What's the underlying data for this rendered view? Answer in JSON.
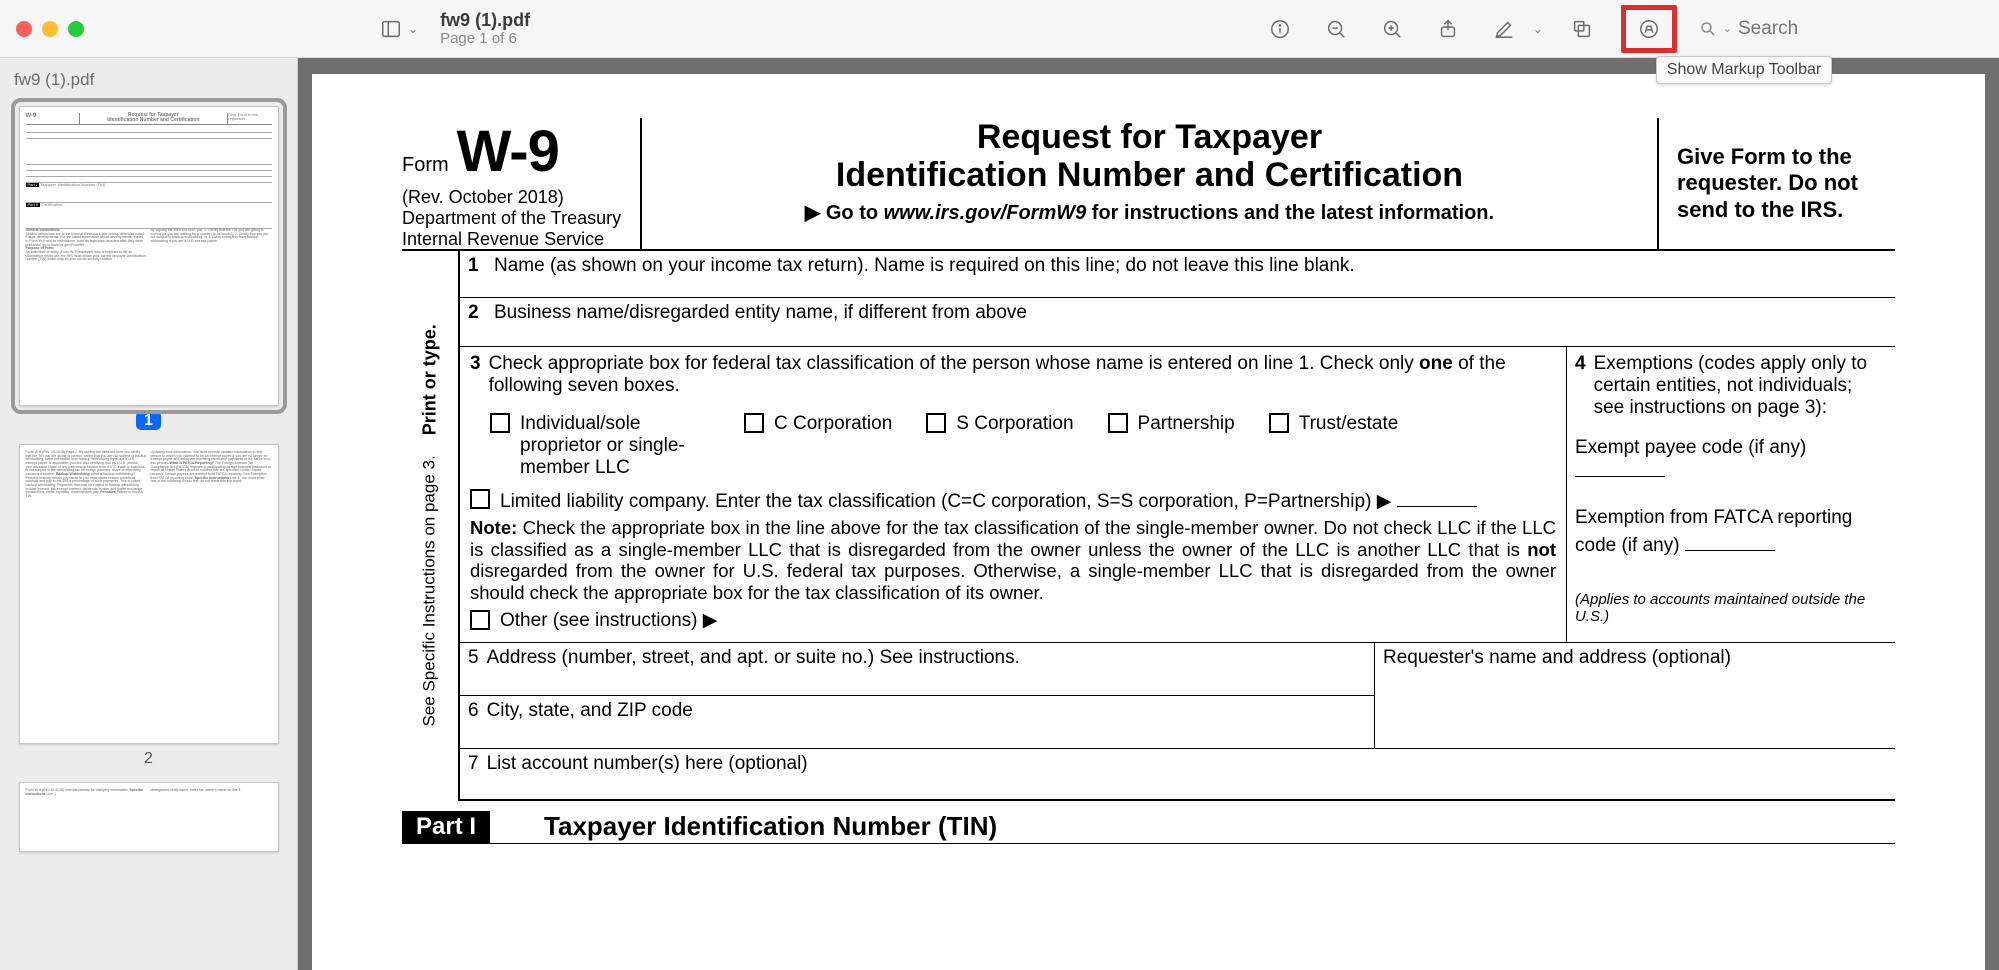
{
  "window": {
    "filename": "fw9 (1).pdf",
    "page_indicator": "Page 1 of 6",
    "sidebar_title": "fw9 (1).pdf",
    "search_placeholder": "Search",
    "tooltip_markup": "Show Markup Toolbar"
  },
  "thumbs": {
    "p1": "1",
    "p2": "2"
  },
  "form": {
    "word_form": "Form",
    "code": "W-9",
    "rev": "(Rev. October 2018)",
    "dept1": "Department of the Treasury",
    "dept2": "Internal Revenue Service",
    "title1": "Request for Taxpayer",
    "title2": "Identification Number and Certification",
    "goto_prefix": "▶ Go to ",
    "goto_url": "www.irs.gov/FormW9",
    "goto_suffix": " for instructions and the latest information.",
    "give": "Give Form to the requester. Do not send to the IRS.",
    "vlabel1": "Print or type.",
    "vlabel2": "See Specific Instructions on page 3.",
    "l1_num": "1",
    "l1": "Name (as shown on your income tax return). Name is required on this line; do not leave this line blank.",
    "l2_num": "2",
    "l2": "Business name/disregarded entity name, if different from above",
    "l3_num": "3",
    "l3a": "Check appropriate box for federal tax classification of the person whose name is entered on line 1. Check only ",
    "l3_one": "one",
    "l3b": " of the following seven boxes.",
    "cb_ind": "Individual/sole proprietor or single-member LLC",
    "cb_c": "C Corporation",
    "cb_s": "S Corporation",
    "cb_p": "Partnership",
    "cb_t": "Trust/estate",
    "cb_llc": "Limited liability company. Enter the tax classification (C=C corporation, S=S corporation, P=Partnership) ▶",
    "note_label": "Note:",
    "note_body_a": " Check the appropriate box in the line above for the tax classification of the single-member owner.  Do not check LLC if the LLC is classified as a single-member LLC that is disregarded from the owner unless the owner of the LLC is another LLC that is ",
    "note_not": "not",
    "note_body_b": " disregarded from the owner for U.S. federal tax purposes. Otherwise, a single-member LLC that is disregarded from the owner should check the appropriate box for the tax classification of its owner.",
    "cb_other": "Other (see instructions) ▶",
    "l4_num": "4",
    "l4": "Exemptions (codes apply only to certain entities, not individuals; see instructions on page 3):",
    "l4_exempt": "Exempt payee code (if any)",
    "l4_fatca": "Exemption from FATCA reporting code (if any)",
    "l4_applies": "(Applies to accounts maintained outside the U.S.)",
    "l5_num": "5",
    "l5": "Address (number, street, and apt. or suite no.) See instructions.",
    "l5r": "Requester's name and address (optional)",
    "l6_num": "6",
    "l6": "City, state, and ZIP code",
    "l7_num": "7",
    "l7": "List account number(s) here (optional)",
    "part1_tag": "Part I",
    "part1_title": "Taxpayer Identification Number (TIN)"
  }
}
